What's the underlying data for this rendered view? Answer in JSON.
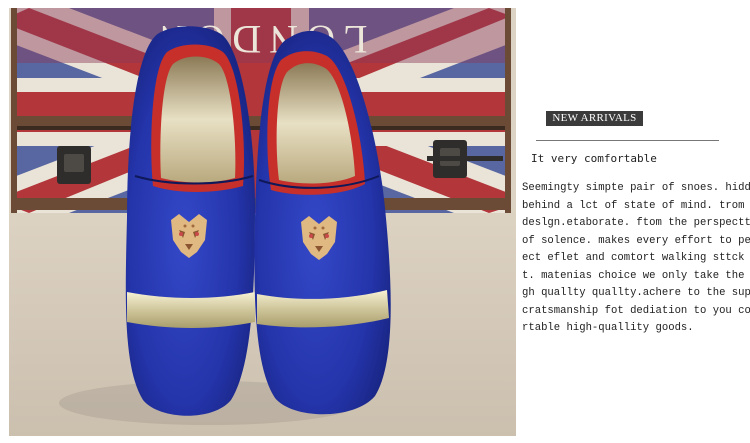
{
  "photo": {
    "trunk_print": "LONDON",
    "colors": {
      "shoe": "#1f2fa6",
      "wall": "#ddd3c4",
      "table": "#d8cfc0",
      "trunk_red": "#b2363a",
      "trunk_blue": "#3d4f95",
      "metal": "#cfc7a2"
    }
  },
  "tag": {
    "label": "NEW ARRIVALS"
  },
  "subtitle": "It very comfortable",
  "description_lines": [
    "Seemingty simpte pair of snoes. hidden",
    "behind a lct of state of mind. trom",
    "deslgn.etaborate. ftom the perspecttve",
    "of solence. makes every effort to perf",
    "ect eflet and comtort walking sttck toc",
    "t. matenias choice we only take the hi",
    "gh quallty quallty.achere to the supetb",
    "cratsmanship fot dediation to you comto",
    "rtable high-quallity goods."
  ]
}
